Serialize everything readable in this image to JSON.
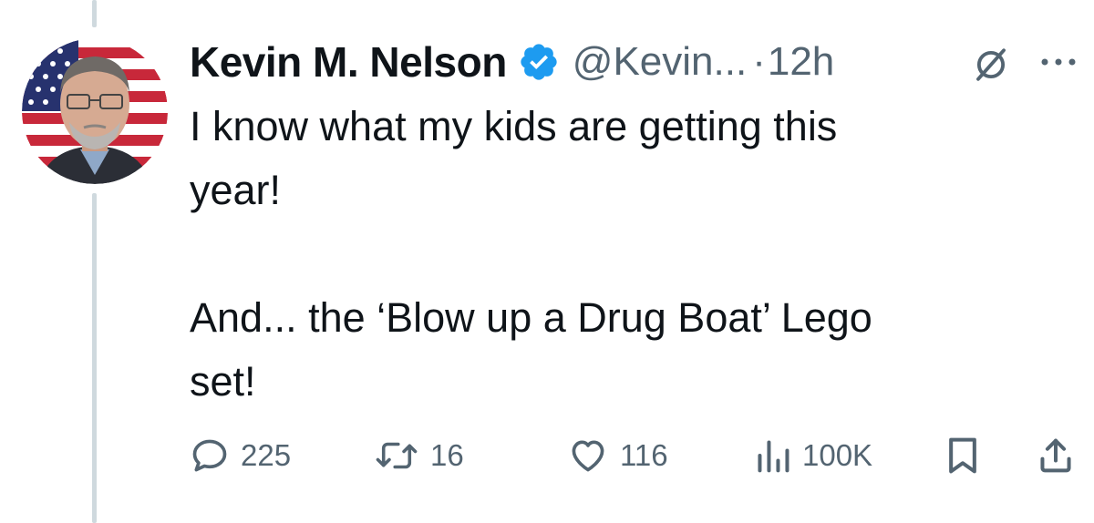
{
  "tweet": {
    "author": {
      "name": "Kevin M. Nelson",
      "handle": "@Kevin...",
      "verified": true,
      "verified_color": "#1d9bf0"
    },
    "time_separator": "·",
    "timestamp": "12h",
    "text_lines": [
      "I know what my kids are getting this",
      "year!",
      "And... the ‘Blow up a Drug Boat’ Lego",
      "set!"
    ],
    "stats": {
      "replies": "225",
      "reposts": "16",
      "likes": "116",
      "views": "100K"
    },
    "icons": [
      "grok-icon",
      "more-icon",
      "reply-icon",
      "repost-icon",
      "like-icon",
      "views-icon",
      "bookmark-icon",
      "share-icon"
    ]
  },
  "colors": {
    "text": "#0f1419",
    "secondary": "#536471",
    "thread_line": "#cfd9de",
    "verified_blue": "#1d9bf0"
  }
}
